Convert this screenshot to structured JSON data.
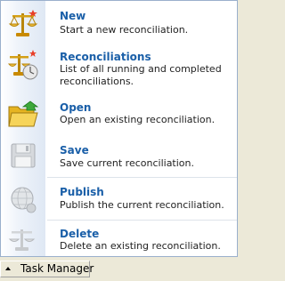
{
  "menu": {
    "items": [
      {
        "title": "New",
        "description": "Start a new reconciliation.",
        "icon": "scales-new-icon"
      },
      {
        "title": "Reconciliations",
        "description": "List of all running and completed reconciliations.",
        "description_lines": [
          "List of all running and completed",
          "reconciliations."
        ],
        "icon": "scales-clock-icon"
      },
      {
        "title": "Open",
        "description": "Open an existing reconciliation.",
        "icon": "folder-open-icon"
      },
      {
        "title": "Save",
        "description": "Save current reconciliation.",
        "icon": "floppy-disk-icon"
      },
      {
        "title": "Publish",
        "description": "Publish the current reconciliation.",
        "icon": "globe-publish-icon"
      },
      {
        "title": "Delete",
        "description": "Delete an existing reconciliation.",
        "icon": "scales-delete-icon"
      }
    ]
  },
  "taskbar": {
    "label": "Task Manager",
    "toggle_icon": "triangle-up-icon"
  },
  "colors": {
    "title": "#1a5fa8",
    "border": "#9ab0cc",
    "background": "#ece9d8"
  }
}
